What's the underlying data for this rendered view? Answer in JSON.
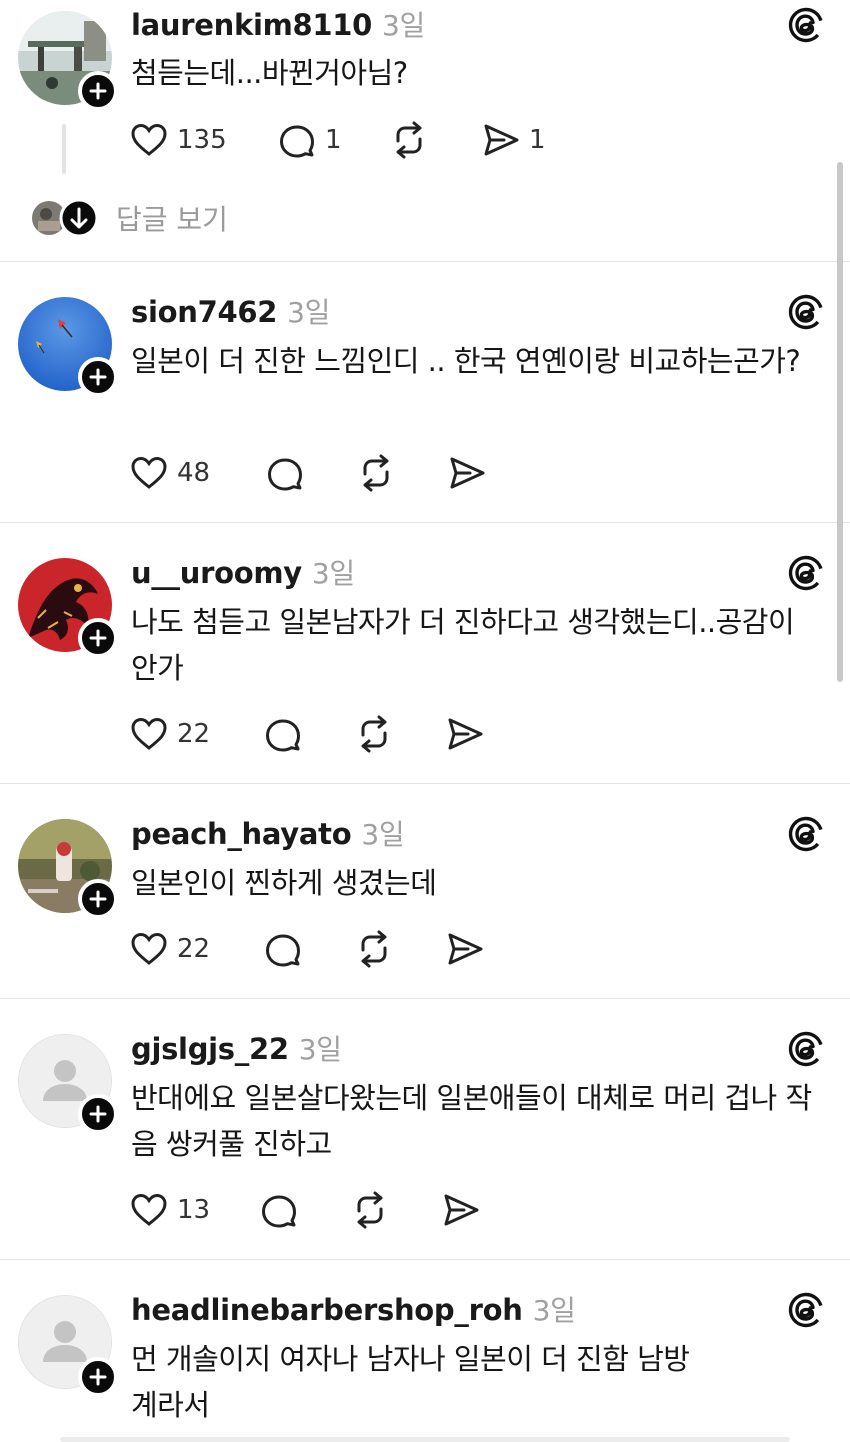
{
  "posts": [
    {
      "username": "laurenkim8110",
      "time": "3일",
      "text": "첨듣는데...바뀐거아님?",
      "likes": "135",
      "comments": "1",
      "shares": "1",
      "avatar": "photo-outdoor-street",
      "replies_label": "답글 보기"
    },
    {
      "username": "sion7462",
      "time": "3일",
      "text": "일본이 더 진한 느낌인디 .. 한국 연옌이랑 비교하는곤가?",
      "likes": "48",
      "avatar": "photo-blue-sky-kite"
    },
    {
      "username": "u__uroomy",
      "time": "3일",
      "text": "나도 첨듣고 일본남자가 더 진하다고 생각했는디..공감이 안가",
      "likes": "22",
      "avatar": "photo-red-illustration"
    },
    {
      "username": "peach_hayato",
      "time": "3일",
      "text": "일본인이 찐하게 생겼는데",
      "likes": "22",
      "avatar": "photo-cafe-dessert"
    },
    {
      "username": "gjslgjs_22",
      "time": "3일",
      "text": "반대에요 일본살다왔는데 일본애들이 대체로 머리 겁나 작음 쌍커풀 진하고",
      "likes": "13",
      "avatar": "default-person-icon"
    },
    {
      "username": "headlinebarbershop_roh",
      "time": "3일",
      "text": "먼 개솔이지 여자나 남자나 일본이 더 진함 남방계라서",
      "avatar": "default-person-icon"
    }
  ],
  "colors": {
    "text": "#161616",
    "muted": "#a0a0a0",
    "divider": "#e6e6e6",
    "badge": "#0a0a0a"
  },
  "icons": [
    "heart-icon",
    "comment-icon",
    "repost-icon",
    "share-icon",
    "threads-logo-icon",
    "plus-icon",
    "arrow-down-icon",
    "person-icon"
  ]
}
